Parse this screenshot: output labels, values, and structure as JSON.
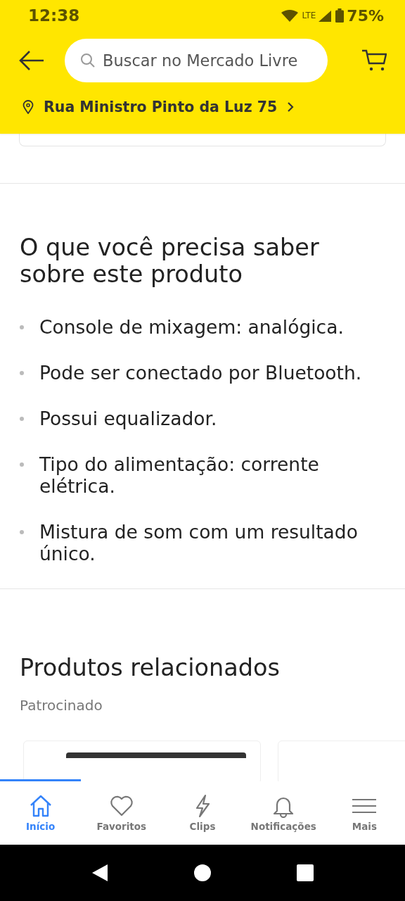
{
  "status_bar": {
    "time": "12:38",
    "lte": "LTE",
    "battery": "75%"
  },
  "header": {
    "search": {
      "placeholder": "Buscar no Mercado Livre"
    },
    "address": "Rua Ministro Pinto da Luz 75"
  },
  "highlights": {
    "title": "O que você precisa saber sobre este produto",
    "items": [
      "Console de mixagem: analógica.",
      "Pode ser conectado por Bluetooth.",
      "Possui equalizador.",
      "Tipo do alimentação: corrente elétrica.",
      "Mistura de som com um resultado único."
    ]
  },
  "related": {
    "title": "Produtos relacionados",
    "subtitle": "Patrocinado"
  },
  "bottom_nav": [
    {
      "label": "Início",
      "selected": true
    },
    {
      "label": "Favoritos",
      "selected": false
    },
    {
      "label": "Clips",
      "selected": false
    },
    {
      "label": "Notificações",
      "selected": false
    },
    {
      "label": "Mais",
      "selected": false
    }
  ]
}
